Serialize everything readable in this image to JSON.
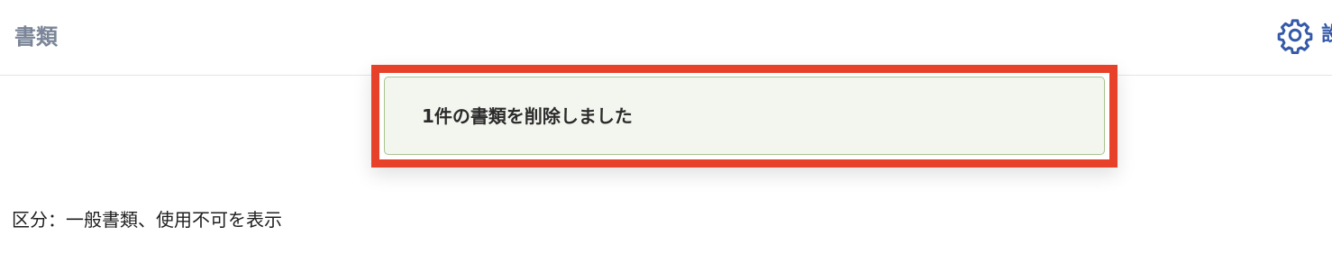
{
  "header": {
    "title": "書類",
    "settings_label": "設定"
  },
  "toast": {
    "message": "1件の書類を削除しました"
  },
  "filter": {
    "summary": "区分：一般書類、使用不可を表示"
  },
  "colors": {
    "title": "#7a8598",
    "accent": "#3559a8",
    "highlight_border": "#e8412a",
    "toast_background": "#f3f6ef",
    "toast_border": "#a9c38f"
  },
  "icons": {
    "settings": "gear-icon"
  }
}
